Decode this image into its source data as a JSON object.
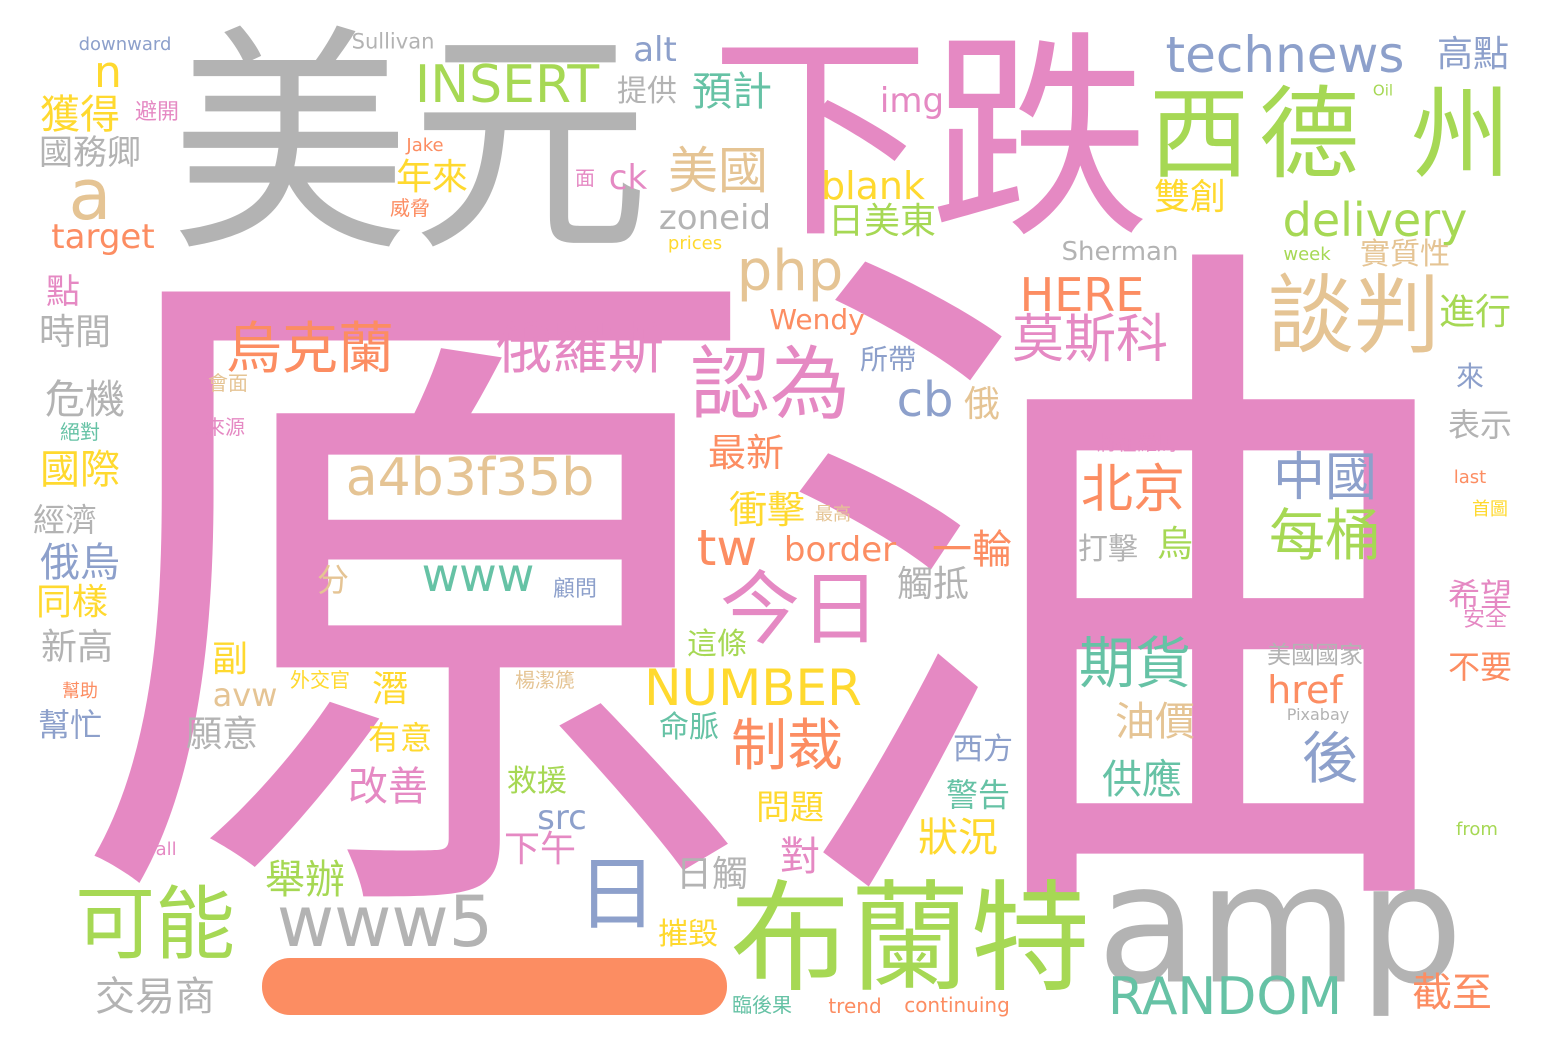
{
  "title": "原油 word cloud",
  "palette": {
    "pink": "#e589c3",
    "gray": "#b3b3b3",
    "green": "#a6d854",
    "blue": "#8da0cb",
    "orange": "#fc8d62",
    "yellow": "#ffd92f",
    "tan": "#e5c494",
    "teal": "#66c2a5"
  },
  "bar_word": "一",
  "words": [
    "原油",
    "美元",
    "下跌",
    "amp",
    "布蘭特",
    "西德 州",
    "technews",
    "高點",
    "delivery",
    "談判",
    "進行",
    "實質性",
    "week",
    "Sherman",
    "HERE",
    "莫斯科",
    "Oil",
    "雙創",
    "來",
    "表示",
    "last",
    "首圖",
    "希望",
    "安全",
    "不要",
    "from",
    "截至",
    "RANDOM",
    "將在羅馬",
    "北京",
    "打擊",
    "烏",
    "中國",
    "每桶",
    "期貨",
    "油價",
    "供應",
    "美國國家",
    "href",
    "Pixabay",
    "後",
    "西方",
    "警告",
    "狀況",
    "觸抵",
    "一輪",
    "border",
    "tw",
    "衝擊",
    "最高",
    "最新",
    "今日",
    "cb",
    "俄",
    "所帶",
    "認為",
    "Wendy",
    "php",
    "日美東",
    "blank",
    "img",
    "預計",
    "zoneid",
    "prices",
    "美國",
    "ck",
    "面",
    "提供",
    "alt",
    "INSERT",
    "Sullivan",
    "downward",
    "n",
    "獲得",
    "避開",
    "國務卿",
    "a",
    "target",
    "Jake",
    "年來",
    "威脅",
    "點",
    "時間",
    "烏克蘭",
    "俄羅斯",
    "會面",
    "來源",
    "危機",
    "絕對",
    "國際",
    "經濟",
    "俄烏",
    "同樣",
    "新高",
    "幫助",
    "幫忙",
    "a4b3f35b",
    "分",
    "www",
    "顧問",
    "副",
    "avw",
    "外交官",
    "潛",
    "願意",
    "有意",
    "改善",
    "楊潔篪",
    "這條",
    "NUMBER",
    "命脈",
    "制裁",
    "救援",
    "src",
    "下午",
    "日",
    "日觸",
    "對",
    "問題",
    "摧毀",
    "舉辦",
    "fall",
    "可能",
    "www5",
    "交易商",
    "臨後果",
    "trend",
    "continuing"
  ]
}
